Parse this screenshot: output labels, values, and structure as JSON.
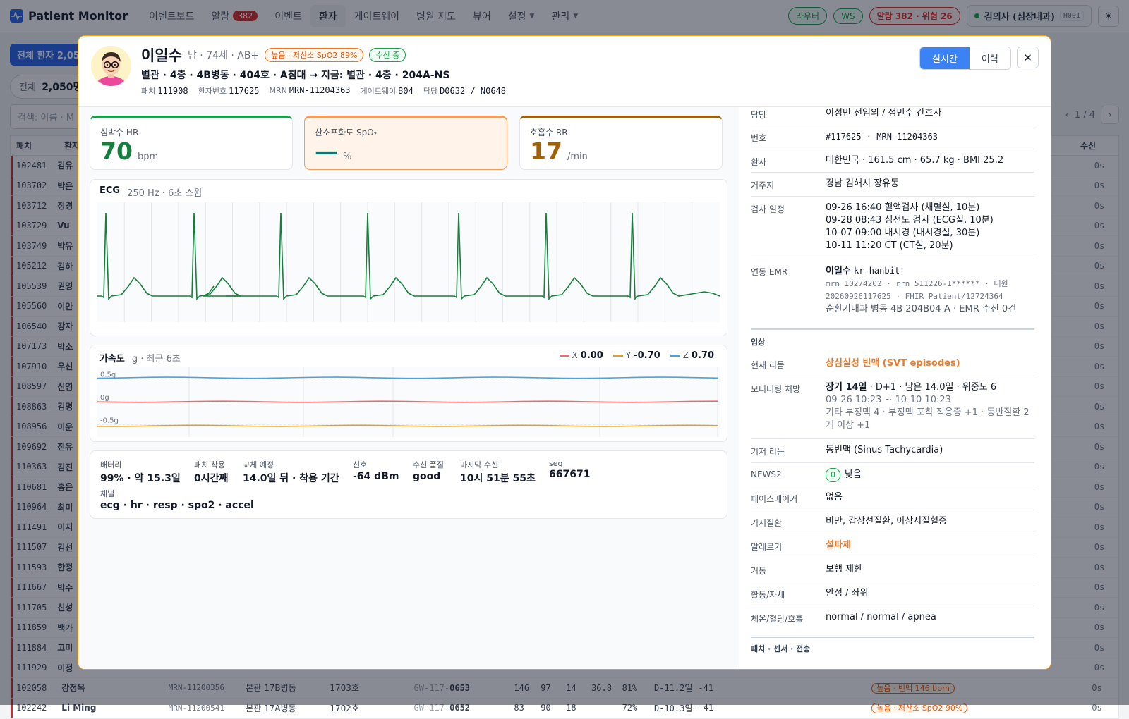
{
  "brand": {
    "name": "Patient Monitor",
    "accent": "#2563eb"
  },
  "nav": [
    {
      "label": "이벤트보드"
    },
    {
      "label": "알람",
      "badge": "382"
    },
    {
      "label": "이벤트"
    },
    {
      "label": "환자",
      "active": true
    },
    {
      "label": "게이트웨이"
    },
    {
      "label": "병원 지도"
    },
    {
      "label": "뷰어"
    },
    {
      "label": "설정",
      "dropdown": true
    },
    {
      "label": "관리",
      "dropdown": true
    }
  ],
  "topright": {
    "router": "라우터",
    "ws": "WS",
    "alarm_summary": "알람 382 · 위험 26",
    "user": "김의사 (심장내과)",
    "user_code": "H001"
  },
  "background": {
    "tag": "전체 환자 2,05",
    "count_label": "전체",
    "count_value": "2,050명",
    "search_placeholder": "검색: 이름 · M",
    "pager": "1 / 4",
    "headers": [
      "패치",
      "환자",
      "수신"
    ],
    "rows": [
      {
        "patch": "102481",
        "name": "김유"
      },
      {
        "patch": "103702",
        "name": "박은"
      },
      {
        "patch": "103712",
        "name": "정경"
      },
      {
        "patch": "103729",
        "name": "Vu"
      },
      {
        "patch": "103749",
        "name": "박유"
      },
      {
        "patch": "105212",
        "name": "김하"
      },
      {
        "patch": "105539",
        "name": "권영"
      },
      {
        "patch": "105560",
        "name": "이안"
      },
      {
        "patch": "106540",
        "name": "강자"
      },
      {
        "patch": "107173",
        "name": "박소"
      },
      {
        "patch": "107910",
        "name": "우신"
      },
      {
        "patch": "108597",
        "name": "신영"
      },
      {
        "patch": "108863",
        "name": "김명"
      },
      {
        "patch": "108956",
        "name": "이운"
      },
      {
        "patch": "109692",
        "name": "전유"
      },
      {
        "patch": "110363",
        "name": "김진"
      },
      {
        "patch": "110681",
        "name": "홍은"
      },
      {
        "patch": "110964",
        "name": "최미"
      },
      {
        "patch": "111491",
        "name": "이지"
      },
      {
        "patch": "111507",
        "name": "김선"
      },
      {
        "patch": "111593",
        "name": "한정"
      },
      {
        "patch": "111667",
        "name": "박수"
      },
      {
        "patch": "111705",
        "name": "신성"
      },
      {
        "patch": "111859",
        "name": "백가"
      },
      {
        "patch": "111884",
        "name": "고미"
      },
      {
        "patch": "111929",
        "name": "이정"
      },
      {
        "patch": "102058",
        "name": "강정옥",
        "mrn": "MRN-11200356",
        "ward": "본관 17B병동",
        "room": "1703호",
        "gw": "GW-117-",
        "gwb": "0653",
        "hr": "146",
        "spo": "97",
        "rr": "14",
        "temp": "36.8",
        "bat": "81%",
        "day": "D-11.2일",
        "sig": "-41",
        "alert": "높음 · 빈맥 146 bpm"
      },
      {
        "patch": "102242",
        "name": "Li Ming",
        "mrn": "MRN-11200541",
        "ward": "본관 17A병동",
        "room": "1702호",
        "gw": "GW-117-",
        "gwb": "0652",
        "hr": "83",
        "spo": "90",
        "rr": "18",
        "temp": "",
        "bat": "72%",
        "day": "D-10.3일",
        "sig": "-41",
        "alert": "높음 · 저산소 SpO2 90%"
      }
    ],
    "recv": "0s"
  },
  "patient": {
    "name": "이일수",
    "meta": "남 · 74세 · AB+",
    "alert_tag": "높음 · 저산소 SpO2 89%",
    "status_tag": "수신 중",
    "location": "별관 · 4층 · 4B병동 · 404호 · A침대 → 지금: 별관 · 4층 · 204A-NS",
    "ids": [
      {
        "k": "패치",
        "v": "111908"
      },
      {
        "k": "환자번호",
        "v": "117625"
      },
      {
        "k": "MRN",
        "v": "MRN-11204363"
      },
      {
        "k": "게이트웨이",
        "v": "804"
      },
      {
        "k": "담당",
        "v": "D0632 / N0648"
      }
    ],
    "view_toggle": [
      "실시간",
      "이력"
    ],
    "close": "✕"
  },
  "vitals": [
    {
      "label": "심박수 HR",
      "value": "70",
      "unit": "bpm",
      "color": "#15803d"
    },
    {
      "label": "산소포화도 SpO₂",
      "value": "—",
      "unit": "%",
      "color": "#0f766e"
    },
    {
      "label": "호흡수 RR",
      "value": "17",
      "unit": "/min",
      "color": "#a16207"
    }
  ],
  "ecg": {
    "title": "ECG",
    "sub": "250 Hz · 6초 스윕",
    "color": "#15803d"
  },
  "accel": {
    "title": "가속도",
    "sub": "g · 최근 6초",
    "axes": [
      {
        "name": "X",
        "value": "0.00",
        "color": "#ef6b6b"
      },
      {
        "name": "Y",
        "value": "-0.70",
        "color": "#e0a030"
      },
      {
        "name": "Z",
        "value": "0.70",
        "color": "#4aa3df"
      }
    ],
    "ticks": [
      "0.5g",
      "0g",
      "-0.5g"
    ]
  },
  "device": [
    {
      "k": "배터리",
      "v": "99% · 약 15.3일"
    },
    {
      "k": "패치 착용",
      "v": "0시간째"
    },
    {
      "k": "교체 예정",
      "v": "14.0일 뒤 · 착용 기간"
    },
    {
      "k": "신호",
      "v": "-64 dBm"
    },
    {
      "k": "수신 품질",
      "v": "good"
    },
    {
      "k": "마지막 수신",
      "v": "10시 51분 55초"
    },
    {
      "k": "seq",
      "v": "667671"
    },
    {
      "k": "채널",
      "v": "ecg · hr · resp · spo2 · accel"
    }
  ],
  "info": {
    "staff": {
      "k": "담당",
      "v": "이성민 전임의 / 정민수 간호사"
    },
    "number": {
      "k": "번호",
      "v": "#117625 · MRN-11204363"
    },
    "patient": {
      "k": "환자",
      "v": "대한민국 · 161.5 cm · 65.7 kg · BMI 25.2"
    },
    "address": {
      "k": "거주지",
      "v": "경남 김해시 장유동"
    },
    "exams": {
      "k": "검사 일정",
      "items": [
        "09-26 16:40 혈액검사 (채혈실, 10분)",
        "09-28 08:43 심전도 검사 (ECG실, 10분)",
        "10-07 09:00 내시경 (내시경실, 30분)",
        "10-11 11:20 CT (CT실, 20분)"
      ]
    },
    "emr": {
      "k": "연동 EMR",
      "name": "이일수",
      "id": "kr-hanbit",
      "line1": "mrn 10274202 · rrn 511226-1****** · 내원",
      "line2": "20260926117625 · FHIR Patient/12724364",
      "line3": "순환기내과 병동 4B 204B04-A · EMR 수신 0건"
    },
    "clinical_title": "임상",
    "rhythm": {
      "k": "현재 리듬",
      "v": "상심실성 빈맥 (SVT episodes)"
    },
    "order": {
      "k": "모니터링 처방",
      "bold": "장기 14일",
      "rest": " · D+1 · 남은 14.0일 · 위중도 6",
      "range": "09-26 10:23 ~ 10-10 10:23",
      "note": "기타 부정맥 4 · 부정맥 포착 적응증 +1 · 동반질환 2개 이상 +1"
    },
    "base_rhythm": {
      "k": "기저 리듬",
      "v": "동빈맥 (Sinus Tachycardia)"
    },
    "news2": {
      "k": "NEWS2",
      "score": "0",
      "v": "낮음"
    },
    "pacemaker": {
      "k": "페이스메이커",
      "v": "없음"
    },
    "comorbid": {
      "k": "기저질환",
      "v": "비만, 갑상선질환, 이상지질혈증"
    },
    "allergy": {
      "k": "알레르기",
      "v": "설파제"
    },
    "mobility": {
      "k": "거동",
      "v": "보행 제한"
    },
    "activity": {
      "k": "활동/자세",
      "v": "안정 / 좌위"
    },
    "temp": {
      "k": "체온/혈당/호흡",
      "v": "normal / normal / apnea"
    },
    "sensor_title": "패치 · 센서 · 전송"
  }
}
